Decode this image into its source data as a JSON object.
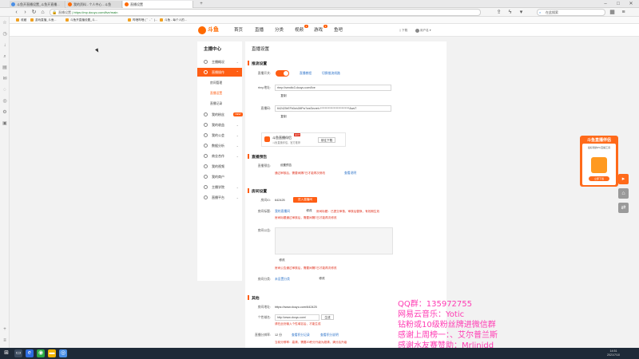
{
  "browser": {
    "tabs": [
      {
        "label": "斗鱼开直播设置_斗鱼开直播..."
      },
      {
        "label": "我的资料 - 个人中心 - 斗鱼"
      },
      {
        "label": "直播设置"
      }
    ],
    "url": "https://mp.douyu.com/live/main",
    "url_prefix": "直播设置",
    "search_placeholder": "在此搜索",
    "bookmarks": [
      "收藏",
      "游戏直播_斗鱼...",
      "斗鱼开直播设置_斗...",
      "哔哩哔哩 ( ゜- ゜)...",
      "斗鱼 - 每个人的...",
      "我要开直播_斗鱼...",
      "直播设置_直播..."
    ],
    "window_controls": {
      "min": "–",
      "max": "□",
      "close": "✕"
    }
  },
  "site_header": {
    "logo_text": "斗鱼",
    "nav": [
      "首页",
      "直播",
      "分类",
      "视频",
      "游戏",
      "鱼吧"
    ],
    "nav_badges": {
      "视频": "1",
      "游戏": "3"
    },
    "download": "下载",
    "user": "用户名"
  },
  "sidebar": {
    "title": "主播中心",
    "items": [
      {
        "label": "主播概况"
      },
      {
        "label": "直播操作"
      },
      {
        "label": "我的粉丝"
      },
      {
        "label": "我的收益"
      },
      {
        "label": "我的公会"
      },
      {
        "label": "数据分析"
      },
      {
        "label": "商业合作"
      },
      {
        "label": "我的视频"
      },
      {
        "label": "我的商户"
      },
      {
        "label": "主播学院"
      },
      {
        "label": "直播平台"
      }
    ],
    "subitems": [
      "房间管理",
      "直播设置",
      "直播记录"
    ],
    "new_tag": "NEW"
  },
  "main": {
    "title": "直播设置",
    "sections": {
      "stream": "推流设置",
      "notice": "直播预告",
      "room": "房间设置",
      "other": "其他"
    },
    "stream": {
      "toggle_label": "直播开关:",
      "link1": "直播教程",
      "link2": "切换推流线路",
      "rtmp_label": "rtmp地址:",
      "rtmp_value": "rtmp://sendtc3.douyu.com/live",
      "copy": "复制",
      "code_label": "直播码:",
      "code_value": "642425rEFb0zbJMFw?wsSecret=**************************&wsT",
      "copy2": "复制"
    },
    "assistant": {
      "title": "斗鱼直播伴侣",
      "sub": "斗鱼直播伴侣，官方推荐",
      "hot": "HOT",
      "btn": "前往下载"
    },
    "notice": {
      "label": "直播预告:",
      "btn": "设置预告",
      "warn": "通过审核后，需要间隔7日才能再次修改",
      "link": "查看说明"
    },
    "room": {
      "id_label": "房间ID:",
      "id_value": "642425",
      "id_btn": "进入直播间",
      "title_label": "房间标题:",
      "title_value": "我的直播间",
      "title_edit": "修改",
      "title_note": "房间标题：已提交审核，审核后替换，有效期生效",
      "title_warn": "房间标题通过审核后，需要间隔7日才能再次修改",
      "intro_label": "房间公告:",
      "intro_edit": "修改",
      "intro_warn": "房间公告通过审核后，需要间隔7日才能再次修改",
      "cat_label": "房间分类:",
      "cat_link": "未设置分类",
      "cat_btn": "修改"
    },
    "other": {
      "addr_label": "房间地址:",
      "addr_value": "https://www.douyu.com/642425",
      "custom_label": "个性域名:",
      "custom_value": "http://www.douyu.com/",
      "custom_btn": "生成",
      "custom_warn": "请在此处输入个性域名后，才能生成",
      "size_label": "直播分辨率:",
      "size_value": "12 分",
      "size_link1": "查看积分记录",
      "size_link2": "查看积分说明",
      "size_warn": "当前分辨率：高清，需要20积分升级为超清，满分后升级"
    }
  },
  "side_float": {
    "title": "斗鱼直播伴侣",
    "sub": "最好用的PC直播工具",
    "btn": "立即下载"
  },
  "overlay": {
    "line1": "QQ群：135972755",
    "line2": "网易云音乐：Yotic",
    "line3": "钻粉或10级粉丝牌进微信群",
    "line4": "感谢上周榜一：、艾尔普兰斯",
    "line5": "感谢水友赛赞助：Mrlinidd"
  },
  "taskbar": {
    "time": "14:51",
    "date": "2021/7/10"
  },
  "colors": {
    "accent": "#ff5e14",
    "overlay_text": "#ff3bb3"
  }
}
